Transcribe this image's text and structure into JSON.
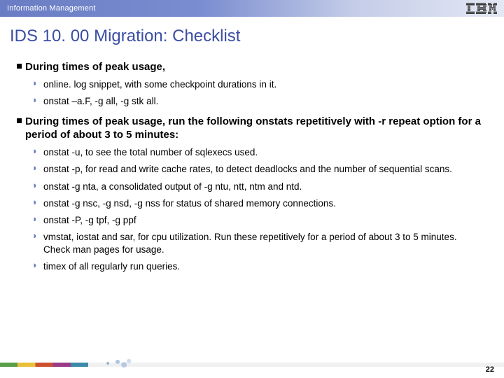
{
  "header": {
    "label": "Information Management"
  },
  "title": "IDS 10. 00 Migration: Checklist",
  "sections": [
    {
      "head": "During times of peak usage,",
      "items": [
        "online. log snippet, with some checkpoint durations in it.",
        "onstat –a.F, -g all, -g stk all."
      ]
    },
    {
      "head": "During times of peak usage, run the following onstats repetitively with -r repeat option for a period of about 3 to 5 minutes:",
      "items": [
        "onstat -u, to see the total number of sqlexecs used.",
        "onstat -p, for read and write cache rates, to detect deadlocks and the number of sequential scans.",
        "onstat  -g nta, a consolidated output of -g ntu, ntt, ntm and ntd.",
        "onstat -g nsc, -g nsd, -g nss for status of shared memory connections.",
        "onstat -P, -g tpf, -g ppf",
        "vmstat, iostat and sar, for cpu utilization. Run these repetitively for a period of about 3 to 5 minutes. Check man pages for usage.",
        "timex of all regularly run queries."
      ]
    }
  ],
  "page_number": "22"
}
